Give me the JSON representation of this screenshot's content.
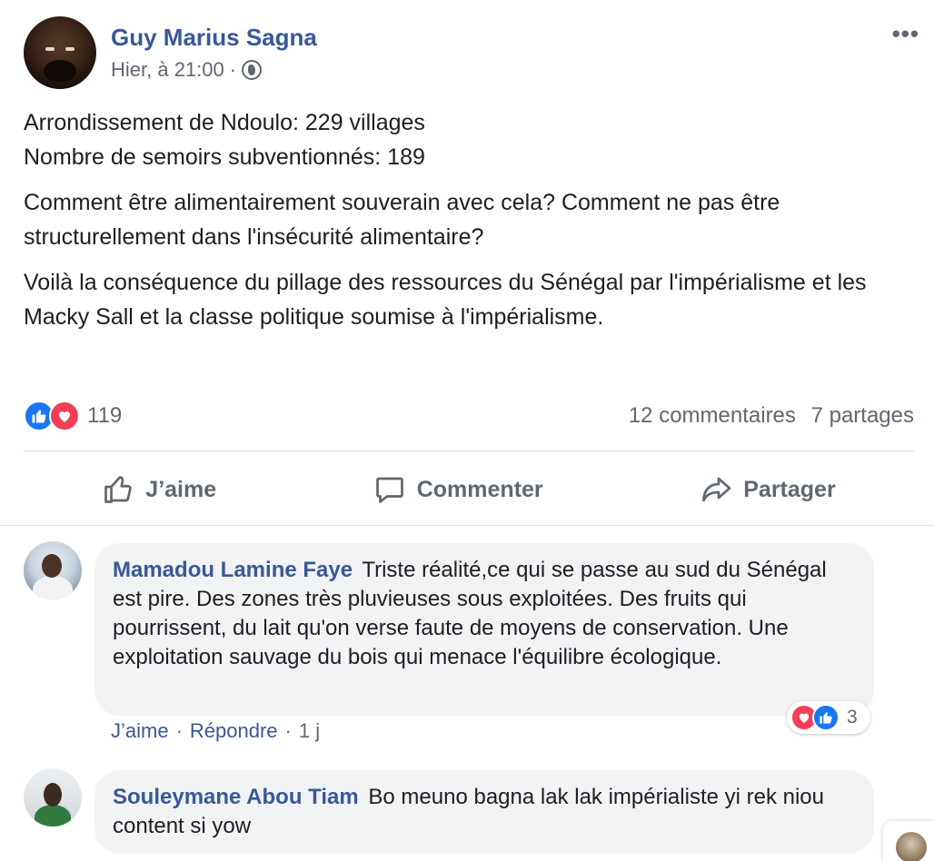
{
  "post": {
    "author": "Guy Marius Sagna",
    "timestamp": "Hier, à 21:00",
    "separator": "·",
    "more_label": "•••",
    "paragraphs": [
      "Arrondissement de Ndoulo: 229 villages",
      "Nombre de semoirs subventionnés: 189",
      "Comment être alimentairement souverain avec cela? Comment ne pas être structurellement dans l'insécurité alimentaire?",
      "Voilà la conséquence du pillage des ressources du Sénégal par l'impérialisme et les Macky Sall et la classe politique soumise à l'impérialisme."
    ],
    "reaction_count": "119",
    "comments_count": "12 commentaires",
    "shares_count": "7 partages",
    "actions": {
      "like": "J’aime",
      "comment": "Commenter",
      "share": "Partager"
    }
  },
  "comments": [
    {
      "author": "Mamadou Lamine Faye",
      "text": "Triste réalité,ce qui se passe au sud du Sénégal est pire. Des zones très pluvieuses sous exploitées. Des fruits qui pourrissent, du lait qu'on verse faute de moyens de conservation. Une exploitation sauvage du bois qui menace l'équilibre écologique.",
      "reaction_count": "3",
      "like_label": "J’aime",
      "reply_label": "Répondre",
      "time": "1 j"
    },
    {
      "author": "Souleymane Abou Tiam",
      "text": "Bo meuno bagna lak lak impérialiste yi rek niou content si yow"
    }
  ],
  "icons": [
    "globe-icon",
    "like-reaction-icon",
    "love-reaction-icon",
    "thumbs-up-icon",
    "comment-icon",
    "share-icon",
    "more-icon"
  ],
  "colors": {
    "link_blue": "#385898",
    "muted": "#606770",
    "like_blue": "#1877f2",
    "love_red": "#f33e58",
    "bubble": "#f2f3f5"
  }
}
